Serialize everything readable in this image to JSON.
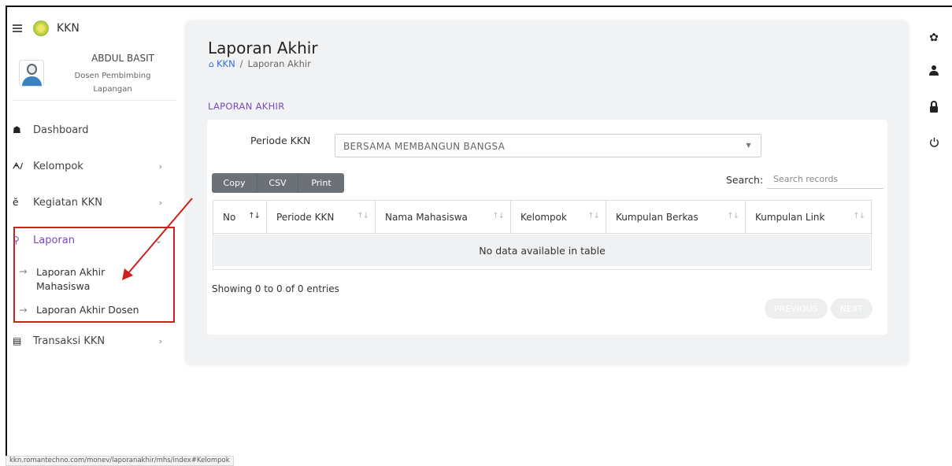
{
  "app": {
    "brand": "KKN"
  },
  "profile": {
    "name": "ABDUL BASIT",
    "role": "Dosen Pembimbing Lapangan"
  },
  "sidebar": {
    "items": [
      {
        "label": "Dashboard",
        "icon": "home-icon",
        "glyph": "☗"
      },
      {
        "label": "Kelompok",
        "icon": "users-icon",
        "glyph": "𝄞",
        "chevron": "›"
      },
      {
        "label": "Kegiatan KKN",
        "icon": "activity-icon",
        "glyph": "ӗ",
        "chevron": "›"
      },
      {
        "label": "Laporan",
        "icon": "search-report-icon",
        "glyph": "⚲",
        "chevron": "⌄",
        "active": true
      },
      {
        "label": "Transaksi KKN",
        "icon": "book-icon",
        "glyph": "▤",
        "chevron": "›"
      }
    ],
    "sub_items": [
      {
        "label": "Laporan Akhir Mahasiswa",
        "dash": "→"
      },
      {
        "label": "Laporan Akhir Dosen",
        "dash": "→"
      }
    ]
  },
  "page": {
    "title": "Laporan Akhir",
    "breadcrumb": {
      "home": "KKN",
      "separator": "/",
      "current": "Laporan Akhir"
    },
    "section_label": "LAPORAN AKHIR"
  },
  "form": {
    "periode_label": "Periode KKN",
    "periode_value": "BERSAMA MEMBANGUN BANGSA"
  },
  "toolbar": {
    "copy": "Copy",
    "csv": "CSV",
    "print": "Print"
  },
  "search": {
    "label": "Search:",
    "placeholder": "Search records"
  },
  "table": {
    "columns": [
      "No",
      "Periode KKN",
      "Nama Mahasiswa",
      "Kelompok",
      "Kumpulan Berkas",
      "Kumpulan Link"
    ],
    "sort_glyph": "↑↓",
    "empty_text": "No data available in table"
  },
  "footer": {
    "showing": "Showing 0 to 0 of 0 entries",
    "previous": "PREVIOUS",
    "next": "NEXT"
  },
  "right_icons": [
    "settings-icon",
    "user-icon",
    "lock-icon",
    "power-icon"
  ],
  "status_url": "kkn.romantechno.com/monev/laporanakhir/mhs/index#Kelompok",
  "colors": {
    "accent_purple": "#7a4bb8",
    "link_blue": "#2f6fd6",
    "annotation_red": "#d0201c",
    "button_gray": "#6c7177"
  }
}
